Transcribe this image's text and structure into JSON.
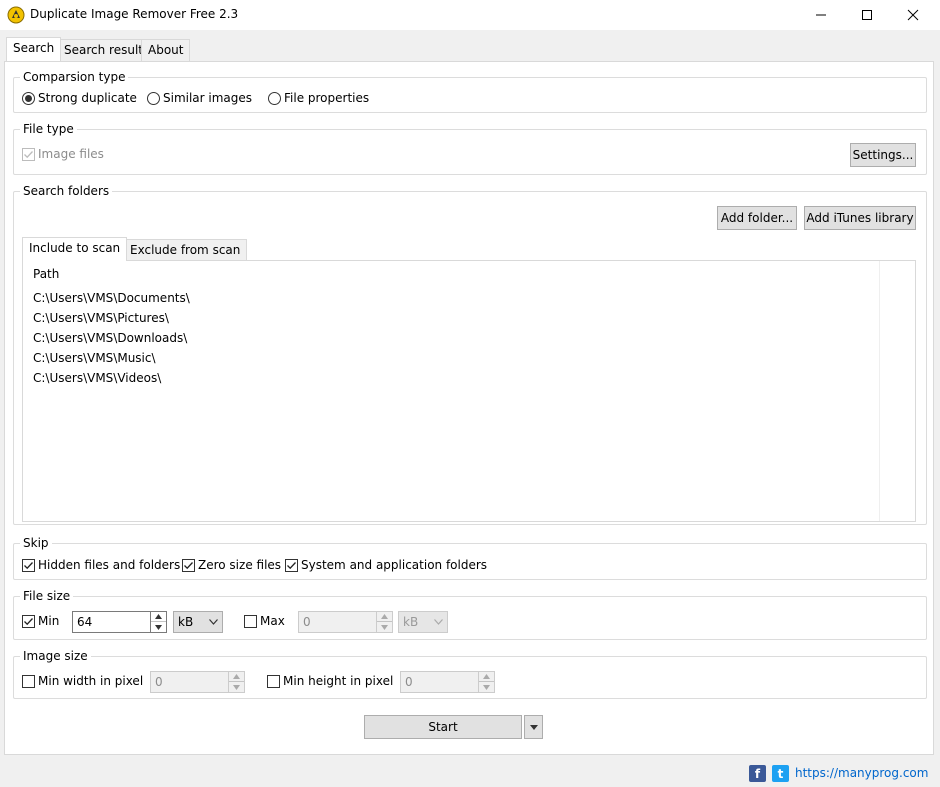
{
  "window": {
    "title": "Duplicate Image Remover Free 2.3",
    "minimize_glyph": "—",
    "icon": "app-logo-icon"
  },
  "tabs": [
    {
      "label": "Search",
      "active": true
    },
    {
      "label": "Search result",
      "active": false
    },
    {
      "label": "About",
      "active": false
    }
  ],
  "comparison": {
    "legend": "Comparsion type",
    "options": [
      {
        "label": "Strong duplicate",
        "selected": true
      },
      {
        "label": "Similar images",
        "selected": false
      },
      {
        "label": "File properties",
        "selected": false
      }
    ]
  },
  "file_type": {
    "legend": "File type",
    "image_files_label": "Image files",
    "image_files_checked": true,
    "settings_label": "Settings..."
  },
  "search_folders": {
    "legend": "Search folders",
    "add_folder_label": "Add folder...",
    "add_itunes_label": "Add iTunes library",
    "inner_tabs": [
      {
        "label": "Include to scan",
        "active": true
      },
      {
        "label": "Exclude from scan",
        "active": false
      }
    ],
    "column_header": "Path",
    "paths": [
      "C:\\Users\\VMS\\Documents\\",
      "C:\\Users\\VMS\\Pictures\\",
      "C:\\Users\\VMS\\Downloads\\",
      "C:\\Users\\VMS\\Music\\",
      "C:\\Users\\VMS\\Videos\\"
    ]
  },
  "skip": {
    "legend": "Skip",
    "options": [
      {
        "label": "Hidden files and folders",
        "checked": true
      },
      {
        "label": "Zero size files",
        "checked": true
      },
      {
        "label": "System and application folders",
        "checked": true
      }
    ]
  },
  "file_size": {
    "legend": "File size",
    "min_label": "Min",
    "min_checked": true,
    "min_value": "64",
    "min_unit": "kB",
    "max_label": "Max",
    "max_checked": false,
    "max_value": "0",
    "max_unit": "kB"
  },
  "image_size": {
    "legend": "Image size",
    "min_width_label": "Min width in pixel",
    "min_width_checked": false,
    "min_width_value": "0",
    "min_height_label": "Min height in pixel",
    "min_height_checked": false,
    "min_height_value": "0"
  },
  "start_label": "Start",
  "footer": {
    "link": "https://manyprog.com",
    "facebook_glyph": "f",
    "twitter_glyph": "t"
  },
  "colors": {
    "facebook": "#3b5998",
    "twitter": "#1da1f2",
    "link": "#0066cc",
    "focus": "#0078d7"
  }
}
